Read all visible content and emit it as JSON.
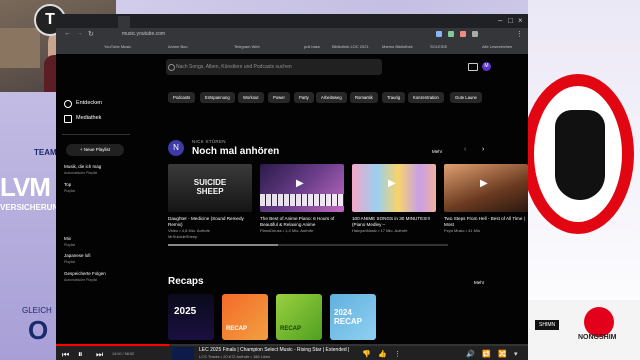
{
  "background": {
    "team_label": "TEAMC",
    "sponsor_big": "LVM",
    "sponsor_small": "VERSICHERUNG",
    "gleich": "GLEICH",
    "o": "O",
    "nongshim": "NONGSHIM",
    "mid_sponsor": "SHIMN"
  },
  "browser": {
    "url": "music.youtube.com",
    "bookmarks": [
      "YouTube Music",
      "Anime Boo",
      "Telegram Web",
      "pull base",
      "Bibliothek LOC 2021",
      "Marino Bibliothek",
      "SOLEIDE",
      "Alle Lesezeichen"
    ]
  },
  "ytm": {
    "search_placeholder": "Nach Songs, Alben, Künstlern und Podcasts suchen",
    "avatar_letter": "M",
    "sidebar": {
      "explore": "Entdecken",
      "library": "Mediathek",
      "new_playlist": "+ Neue Playlist",
      "playlists": [
        {
          "title": "Musik, die ich mag",
          "sub": "Automatische Playlist"
        },
        {
          "title": "Top",
          "sub": "Playlist"
        },
        {
          "title": "Mix",
          "sub": "Playlist"
        },
        {
          "title": "Japanese lofi",
          "sub": "Playlist"
        },
        {
          "title": "Gespeicherte Folgen",
          "sub": "Automatische Playlist"
        }
      ]
    },
    "chips": [
      "Podcasts",
      "Entspannung",
      "Workout",
      "Power",
      "Party",
      "Arbeitsweg",
      "Romantik",
      "Traurig",
      "Konzentration",
      "Gute Laune"
    ],
    "section": {
      "avatar_letter": "N",
      "kicker": "NICK STÜREN",
      "title": "Noch mal anhören",
      "more": "Mehr",
      "cards": [
        {
          "title": "Daughter - Medicine (Sound Remedy Remix)",
          "sub": "Video • 4,8 Mio. Aufrufe",
          "sub2": "MrSuicideSheep",
          "thumb_text": "SUICIDE SHEEP"
        },
        {
          "title": "The Best of Anime Piano: 6 Hours of Beautiful & Relaxing Anime",
          "sub": "PianoDeuss • 1,4 Mio. Aufrufe",
          "sub2": ""
        },
        {
          "title": "100 ANIME SONGS in 30 MINUTES!!! (Piano Medley –",
          "sub": "HalcyonMusic • 17 Mio. Aufrufe",
          "sub2": ""
        },
        {
          "title": "Two Steps From Hell - Best of All Time | Most",
          "sub": "Feya Music • 41 Mio",
          "sub2": ""
        }
      ]
    },
    "recaps": {
      "title": "Recaps",
      "more": "Mehr",
      "tiles": [
        "2025",
        "RECAP",
        "RECAP",
        "2024 RECAP"
      ]
    },
    "player": {
      "time": "14:00 / 58:52",
      "title": "LEC 2025 Finals | Champion Select Music - Rising Star | Extended |",
      "sub": "LCS Tracks • 20.672 Aufrufe • 186 Likes",
      "progress": 0.24
    }
  }
}
